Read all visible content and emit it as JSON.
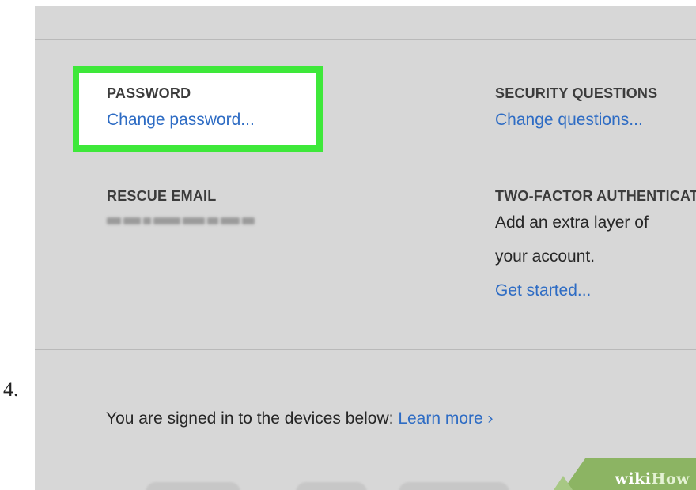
{
  "step": {
    "number": "4."
  },
  "security": {
    "password": {
      "label": "PASSWORD",
      "link": "Change password..."
    },
    "security_questions": {
      "label": "SECURITY QUESTIONS",
      "link": "Change questions..."
    },
    "rescue_email": {
      "label": "RESCUE EMAIL"
    },
    "two_factor": {
      "label": "TWO-FACTOR AUTHENTICATION",
      "description_line1": "Add an extra layer of",
      "description_line2": "your account.",
      "link": "Get started..."
    }
  },
  "devices": {
    "text": "You are signed in to the devices below:",
    "link": "Learn more ›"
  },
  "watermark": {
    "part1": "wiki",
    "part2": "How"
  },
  "colors": {
    "highlight": "#3ee83a",
    "link": "#2e6cc4",
    "panel_background": "#d7d7d7",
    "watermark_green": "#8cb463"
  }
}
